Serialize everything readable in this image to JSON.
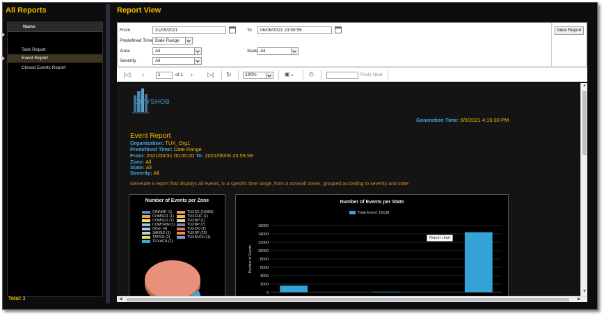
{
  "left_panel": {
    "title": "All Reports",
    "column_header": "Name",
    "items": [
      {
        "label": "Task Report"
      },
      {
        "label": "Event Report"
      },
      {
        "label": "Closed Events Report"
      }
    ],
    "total_label": "Total:",
    "total_value": "3"
  },
  "right_panel": {
    "title": "Report View",
    "filters": {
      "from_label": "From",
      "from_value": "31/05/2021",
      "to_label": "To",
      "to_value": "06/06/2021 23:59:59",
      "predefined_label": "Predefined Time",
      "predefined_value": "Date Range",
      "zone_label": "Zone",
      "zone_value": "All",
      "state_label": "State",
      "state_value": "All",
      "severity_label": "Severity",
      "severity_value": "All",
      "view_button": "View Report"
    },
    "toolbar": {
      "page_value": "1",
      "page_of": "of 1",
      "zoom_value": "100%",
      "find_label": "Find",
      "next_label": "Next",
      "separator": "|"
    }
  },
  "report": {
    "logo_text": "CITYSHOB",
    "generation_label": "Generation Time:",
    "generation_value": "6/6/2021 4:16:30 PM",
    "title": "Event Report",
    "org_label": "Organization:",
    "org_value": "TUX_Org1",
    "predefined_label": "Predefined Time:",
    "predefined_value": "Date Range",
    "from_label": "From:",
    "from_value": "2021/05/31 00:00:00",
    "to_label": "To:",
    "to_value": "2021/06/06 23:59:59",
    "zone_label": "Zone:",
    "zone_value": "All",
    "state_label": "State:",
    "state_value": "All",
    "severity_label": "Severity:",
    "severity_value": "All",
    "description": "Generate a report that displays all events, in a specific time range, from a zone/all zones, grouped according to severity and state",
    "tooltip": "Report chart"
  },
  "chart_data": [
    {
      "type": "pie",
      "title": "Number of Events per Zone",
      "series": [
        {
          "name": "CINNNP (1)",
          "color": "#4a90d9"
        },
        {
          "name": "TUXCE (16089)",
          "color": "#e8907a"
        },
        {
          "name": "COMSO1 (1)",
          "color": "#f0a04a"
        },
        {
          "name": "TUXCHC (1)",
          "color": "#d9c24a"
        },
        {
          "name": "COMSO2 (1)",
          "color": "#f2e05a"
        },
        {
          "name": "TUXNP (1)",
          "color": "#e8d8a0"
        },
        {
          "name": "COMTRIN (1)",
          "color": "#9ac4e8"
        },
        {
          "name": "TUXNP (7)",
          "color": "#7a8ab0"
        },
        {
          "name": "Other (4)",
          "color": "#c0c0c0"
        },
        {
          "name": "TUXOO (1)",
          "color": "#d87a6a"
        },
        {
          "name": "SANSO (1)",
          "color": "#a8d8e8"
        },
        {
          "name": "TUXSP (23)",
          "color": "#f08a3a"
        },
        {
          "name": "TAPSO (2)",
          "color": "#e8d85a"
        },
        {
          "name": "TUXSUCH (1)",
          "color": "#7a9ad8"
        },
        {
          "name": "TUXACA (2)",
          "color": "#3aa8d8"
        }
      ]
    },
    {
      "type": "bar",
      "title": "Number of Events per State",
      "ylabel": "Number of Events",
      "ylim": [
        0,
        16000
      ],
      "yticks": [
        "0",
        "2000",
        "4000",
        "6000",
        "8000",
        "10000",
        "12000",
        "14000",
        "16000"
      ],
      "series": [
        {
          "name": "Total Event: 16136",
          "color": "#35a3d8",
          "values": [
            1600,
            0,
            120,
            0,
            14400
          ]
        }
      ]
    }
  ]
}
